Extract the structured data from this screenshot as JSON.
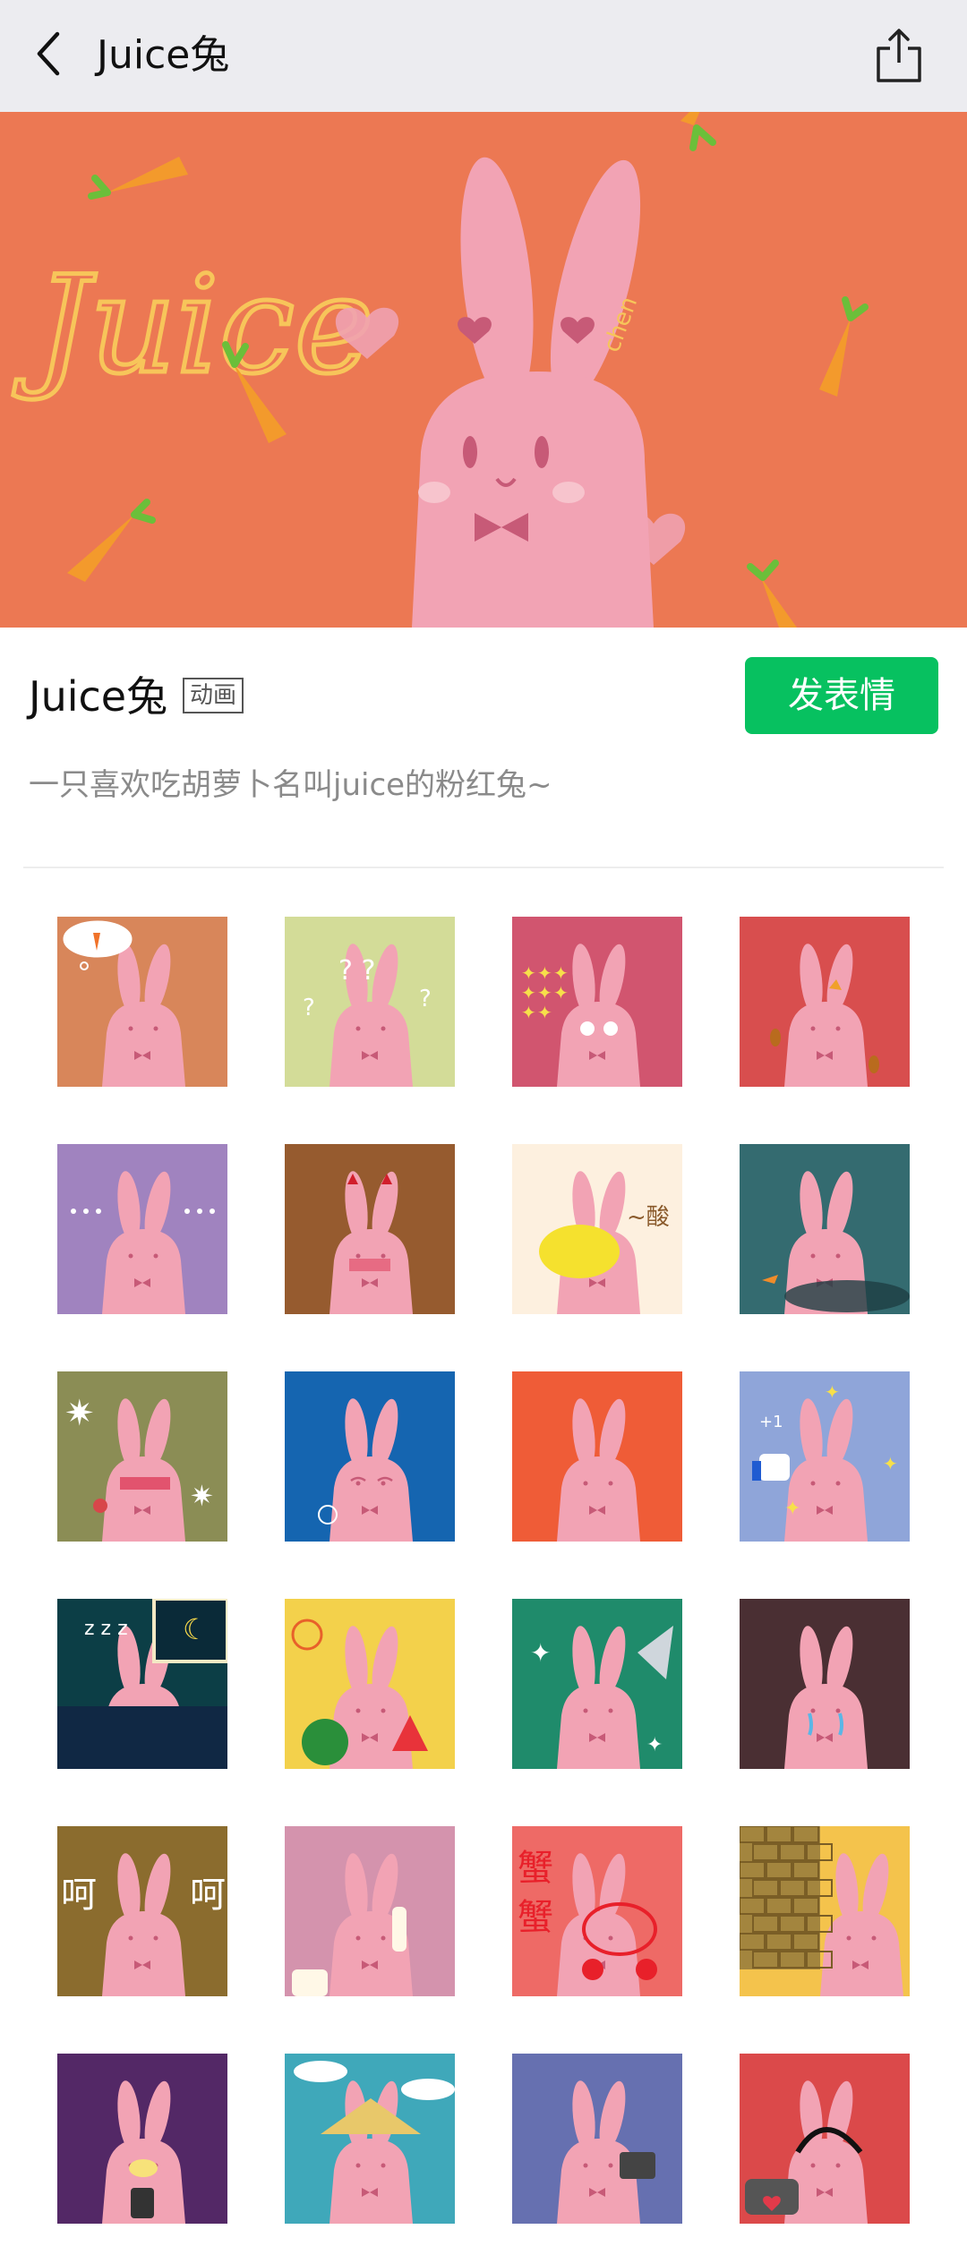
{
  "header": {
    "title": "Juice兔",
    "back_icon": "chevron-left-icon",
    "share_icon": "share-icon"
  },
  "banner": {
    "background": "#ec7853",
    "script_text": "Juice",
    "signature": "chen"
  },
  "pack": {
    "name": "Juice兔",
    "badge": "动画",
    "send_label": "发表情",
    "send_color": "#07c160",
    "description": "一只喜欢吃胡萝卜名叫juice的粉红兔~"
  },
  "stickers": [
    {
      "bg": "#d8865a",
      "overlay": "thought-carrot"
    },
    {
      "bg": "#d3dc98",
      "overlay": "question-marks"
    },
    {
      "bg": "#d1556f",
      "overlay": "sparkles"
    },
    {
      "bg": "#d84e4e",
      "overlay": "carrot-ears"
    },
    {
      "bg": "#a083bf",
      "overlay": "dots"
    },
    {
      "bg": "#965b2f",
      "overlay": "blush"
    },
    {
      "bg": "#fdf0df",
      "overlay": "lemon",
      "text": "~酸"
    },
    {
      "bg": "#346b70",
      "overlay": "back-view"
    },
    {
      "bg": "#8b8d55",
      "overlay": "angry"
    },
    {
      "bg": "#1565b0",
      "overlay": "calm"
    },
    {
      "bg": "#ef5c37",
      "overlay": "plain"
    },
    {
      "bg": "#8fa5d9",
      "overlay": "thumbs-up",
      "text": "+1"
    },
    {
      "bg": "#0c3e46",
      "overlay": "sleeping"
    },
    {
      "bg": "#f3d14b",
      "overlay": "watermelon"
    },
    {
      "bg": "#1f8b6b",
      "overlay": "knife"
    },
    {
      "bg": "#4a2f33",
      "overlay": "crying"
    },
    {
      "bg": "#8b6c2e",
      "overlay": "laugh",
      "text": "呵呵"
    },
    {
      "bg": "#d493ad",
      "overlay": "phone"
    },
    {
      "bg": "#ee6a66",
      "overlay": "crab",
      "text": "蟹蟹"
    },
    {
      "bg": "#f4c34c",
      "overlay": "peek-wall"
    },
    {
      "bg": "#532866",
      "overlay": "drink"
    },
    {
      "bg": "#3fa8ba",
      "overlay": "straw-hat"
    },
    {
      "bg": "#6670b0",
      "overlay": "mirror"
    },
    {
      "bg": "#db494a",
      "overlay": "headphones"
    }
  ]
}
